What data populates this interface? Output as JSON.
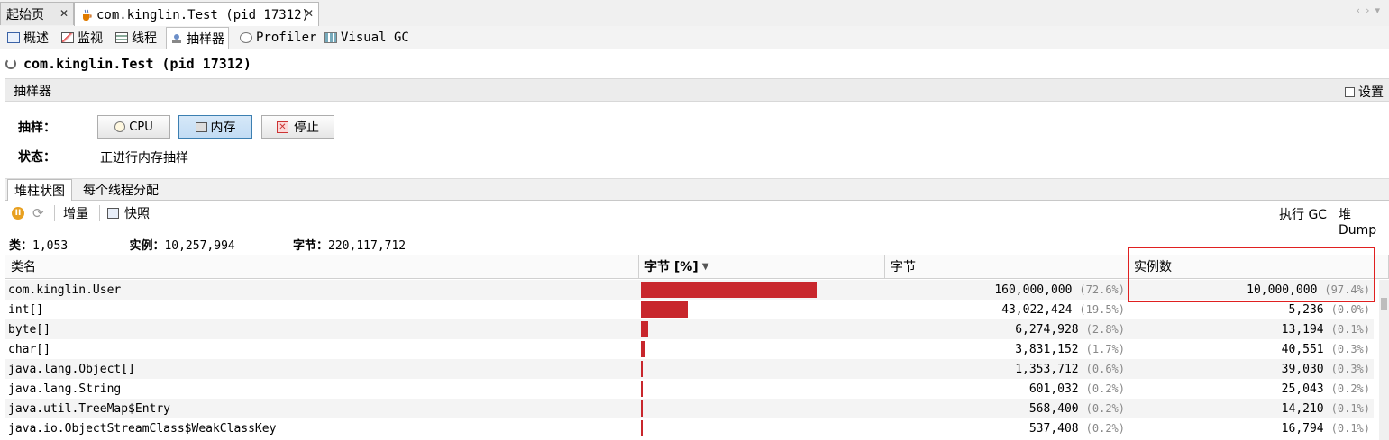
{
  "doc_tabs": [
    {
      "label": "起始页",
      "active": false
    },
    {
      "label": "com.kinglin.Test (pid 17312)",
      "active": true
    }
  ],
  "view_tabs": [
    {
      "label": "概述",
      "icon": "info-icon"
    },
    {
      "label": "监视",
      "icon": "monitor-icon"
    },
    {
      "label": "线程",
      "icon": "threads-icon"
    },
    {
      "label": "抽样器",
      "icon": "sampler-icon"
    },
    {
      "label": "Profiler",
      "icon": "profiler-icon"
    },
    {
      "label": "Visual GC",
      "icon": "visualgc-icon"
    }
  ],
  "process_title": "com.kinglin.Test (pid 17312)",
  "sampler": {
    "header": "抽样器",
    "settings_label": "设置",
    "sample_label": "抽样：",
    "status_label": "状态：",
    "status_value": "正进行内存抽样",
    "buttons": {
      "cpu": "CPU",
      "memory": "内存",
      "stop": "停止"
    }
  },
  "sub_tabs": [
    "堆柱状图",
    "每个线程分配"
  ],
  "toolbar": {
    "delta": "增量",
    "snapshot": "快照",
    "perform_gc": "执行 GC",
    "heap_dump": "堆 Dump"
  },
  "stats": {
    "classes_label": "类：",
    "classes_value": "1,053",
    "instances_label": "实例：",
    "instances_value": "10,257,994",
    "bytes_label": "字节：",
    "bytes_value": "220,117,712"
  },
  "table": {
    "columns": [
      "类名",
      "字节 [%]",
      "字节",
      "实例数"
    ],
    "rows": [
      {
        "name": "com.kinglin.User",
        "bar_fraction": 0.726,
        "bytes": "160,000,000",
        "bytes_pct": "(72.6%)",
        "instances": "10,000,000",
        "instances_pct": "(97.4%)"
      },
      {
        "name": "int[]",
        "bar_fraction": 0.195,
        "bytes": "43,022,424",
        "bytes_pct": "(19.5%)",
        "instances": "5,236",
        "instances_pct": "(0.0%)"
      },
      {
        "name": "byte[]",
        "bar_fraction": 0.028,
        "bytes": "6,274,928",
        "bytes_pct": "(2.8%)",
        "instances": "13,194",
        "instances_pct": "(0.1%)"
      },
      {
        "name": "char[]",
        "bar_fraction": 0.017,
        "bytes": "3,831,152",
        "bytes_pct": "(1.7%)",
        "instances": "40,551",
        "instances_pct": "(0.3%)"
      },
      {
        "name": "java.lang.Object[]",
        "bar_fraction": 0.006,
        "bytes": "1,353,712",
        "bytes_pct": "(0.6%)",
        "instances": "39,030",
        "instances_pct": "(0.3%)"
      },
      {
        "name": "java.lang.String",
        "bar_fraction": 0.002,
        "bytes": "601,032",
        "bytes_pct": "(0.2%)",
        "instances": "25,043",
        "instances_pct": "(0.2%)"
      },
      {
        "name": "java.util.TreeMap$Entry",
        "bar_fraction": 0.002,
        "bytes": "568,400",
        "bytes_pct": "(0.2%)",
        "instances": "14,210",
        "instances_pct": "(0.1%)"
      },
      {
        "name": "java.io.ObjectStreamClass$WeakClassKey",
        "bar_fraction": 0.002,
        "bytes": "537,408",
        "bytes_pct": "(0.2%)",
        "instances": "16,794",
        "instances_pct": "(0.1%)"
      }
    ]
  },
  "colors": {
    "bar": "#c8262c",
    "highlight": "#e02020",
    "pressed": "#3c7fb1"
  }
}
